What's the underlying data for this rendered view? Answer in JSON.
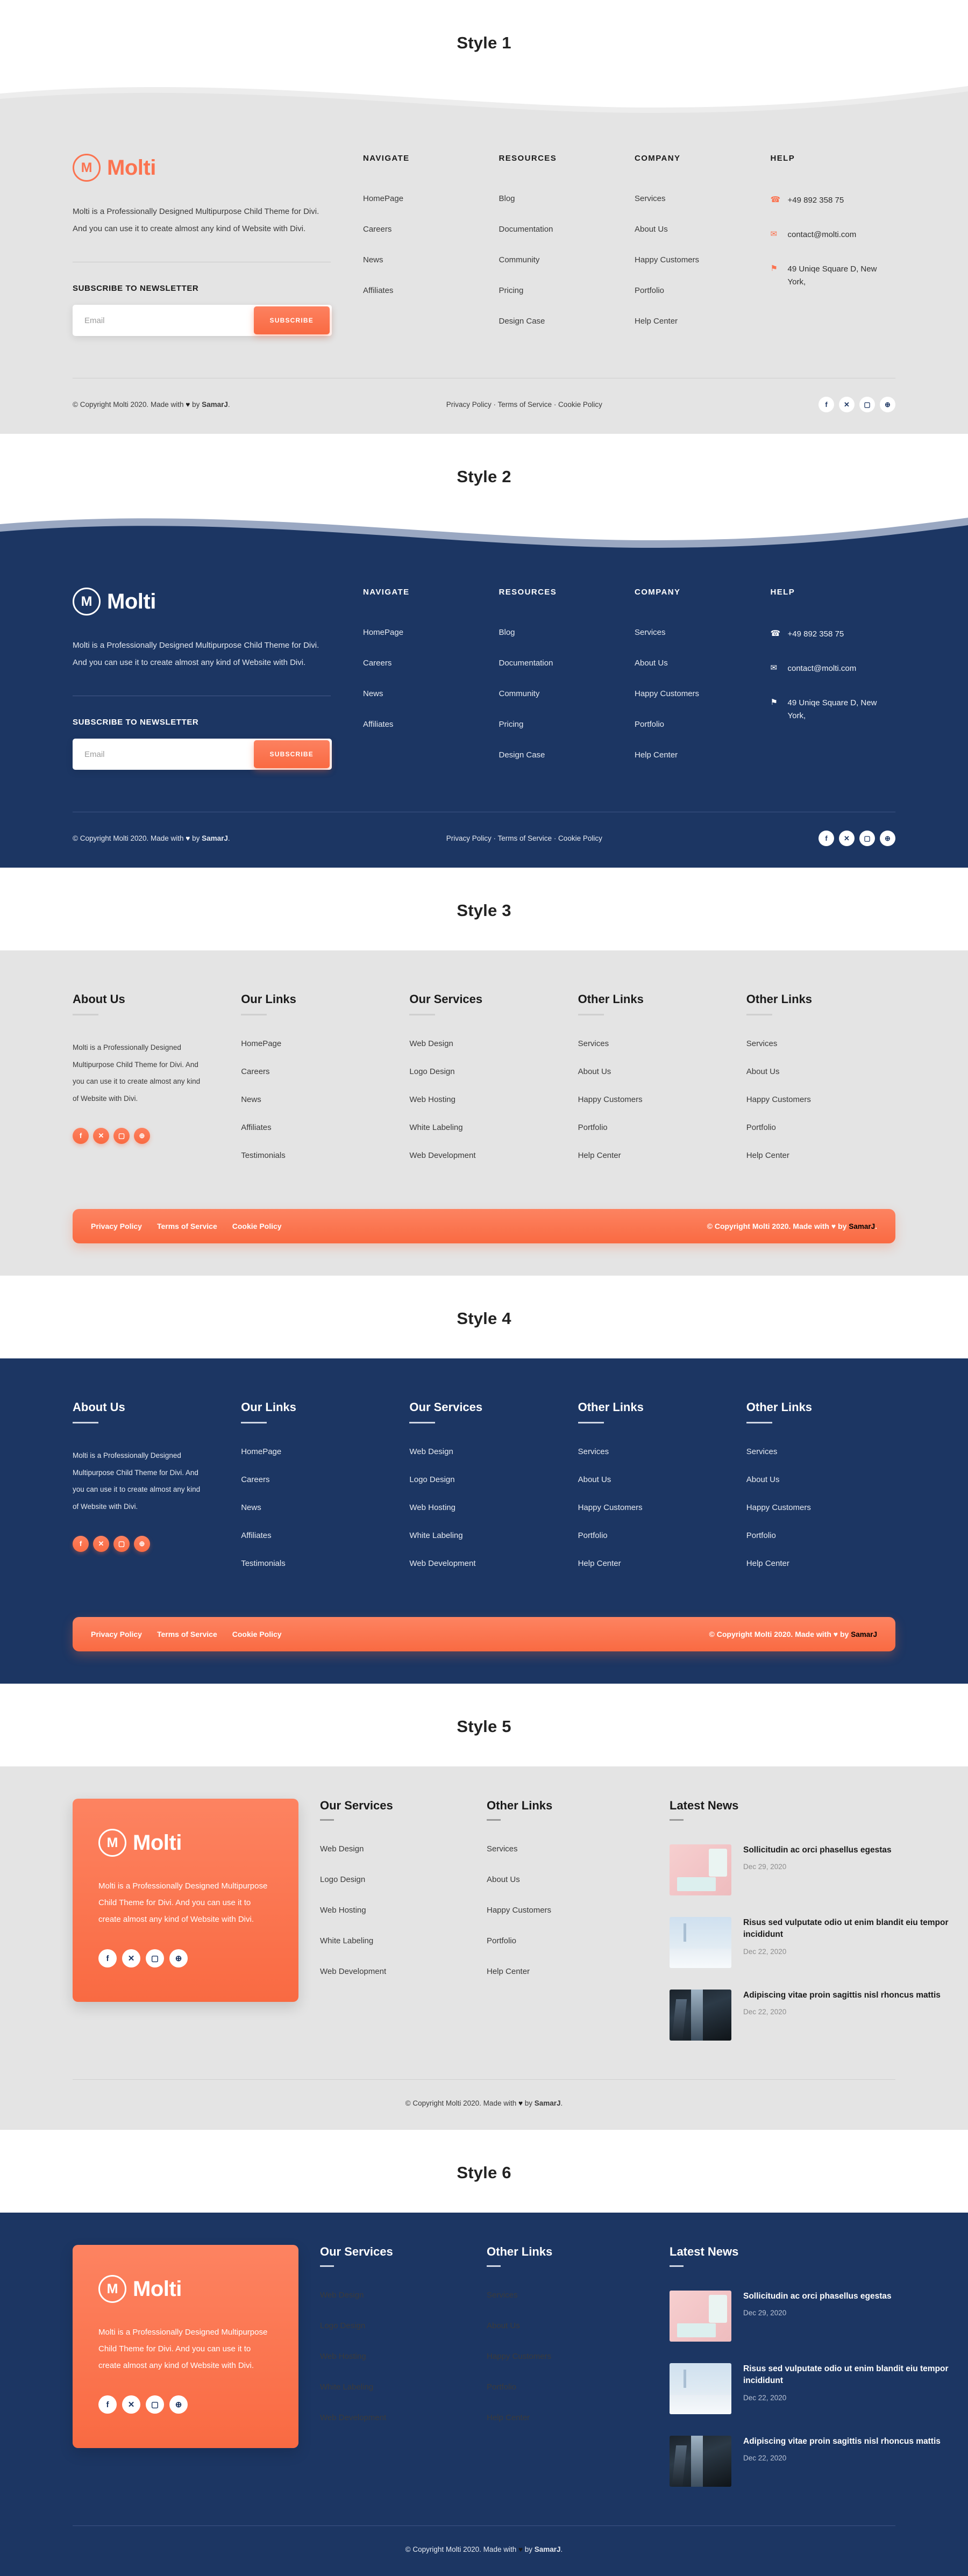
{
  "brand": {
    "name": "Molti",
    "logo_mark": "M",
    "accent": "#fb7350",
    "navy": "#1c3663",
    "light_bg": "#e4e4e4"
  },
  "styles": [
    {
      "label": "Style 1"
    },
    {
      "label": "Style 2"
    },
    {
      "label": "Style 3"
    },
    {
      "label": "Style 4"
    },
    {
      "label": "Style 5"
    },
    {
      "label": "Style 6"
    }
  ],
  "about": {
    "text": "Molti is a Professionally Designed  Multipurpose Child Theme for Divi. And you can use it to create almost any kind of Website with Divi."
  },
  "newsletter": {
    "title": "SUBSCRIBE TO NEWSLETTER",
    "placeholder": "Email",
    "value": "",
    "button": "SUBSCRIBE"
  },
  "columns": {
    "navigate": {
      "heading": "NAVIGATE",
      "items": [
        "HomePage",
        "Careers",
        "News",
        "Affiliates"
      ]
    },
    "resources": {
      "heading": "RESOURCES",
      "items": [
        "Blog",
        "Documentation",
        "Community",
        "Pricing",
        "Design Case"
      ]
    },
    "company": {
      "heading": "COMPANY",
      "items": [
        "Services",
        "About Us",
        "Happy Customers",
        "Portfolio",
        "Help Center"
      ]
    },
    "help": {
      "heading": "HELP",
      "phone": "+49 892 358 75",
      "email": "contact@molti.com",
      "address": "49 Uniqe Square D, New York,"
    }
  },
  "five_col": {
    "about_us": {
      "heading": "About Us",
      "text": "Molti is a Professionally Designed Multipurpose Child Theme for Divi. And you can use it to create almost any kind of Website with Divi."
    },
    "our_links": {
      "heading": "Our Links",
      "items": [
        "HomePage",
        "Careers",
        "News",
        "Affiliates",
        "Testimonials"
      ]
    },
    "our_services": {
      "heading": "Our Services",
      "items": [
        "Web Design",
        "Logo Design",
        "Web Hosting",
        "White Labeling",
        "Web Development"
      ]
    },
    "other_links_1": {
      "heading": "Other Links",
      "items": [
        "Services",
        "About Us",
        "Happy Customers",
        "Portfolio",
        "Help Center"
      ]
    },
    "other_links_2": {
      "heading": "Other Links",
      "items": [
        "Services",
        "About Us",
        "Happy Customers",
        "Portfolio",
        "Help Center"
      ]
    }
  },
  "news_layout": {
    "promo_text": "Molti is a Professionally Designed Multipurpose Child Theme for Divi. And you can use it to create almost any kind of Website with Divi.",
    "our_services": {
      "heading": "Our Services",
      "items": [
        "Web Design",
        "Logo Design",
        "Web Hosting",
        "White Labeling",
        "Web Development"
      ]
    },
    "other_links": {
      "heading": "Other Links",
      "items": [
        "Services",
        "About Us",
        "Happy Customers",
        "Portfolio",
        "Help Center"
      ]
    },
    "latest_news": {
      "heading": "Latest News",
      "items": [
        {
          "title": "Sollicitudin ac orci phasellus egestas",
          "date": "Dec 29, 2020",
          "thumb": "pink-desk-photo"
        },
        {
          "title": "Risus sed vulputate odio ut enim blandit eiu tempor incididunt",
          "date": "Dec 22, 2020",
          "thumb": "foggy-city-photo"
        },
        {
          "title": "Adipiscing vitae proin sagittis nisl rhoncus mattis",
          "date": "Dec 22, 2020",
          "thumb": "skyscraper-photo"
        }
      ]
    }
  },
  "footer_bar": {
    "copyright_pre": "© Copyright Molti 2020. Made with ",
    "heart": "♥",
    "copyright_mid": " by ",
    "author": "SamarJ",
    "copyright_post": ".",
    "legal": "Privacy Policy · Terms of Service · Cookie Policy",
    "legal_items": [
      "Privacy Policy",
      "Terms of Service",
      "Cookie Policy"
    ]
  },
  "social": [
    {
      "name": "facebook-icon",
      "glyph": "f"
    },
    {
      "name": "x-twitter-icon",
      "glyph": "✕"
    },
    {
      "name": "instagram-icon",
      "glyph": "▢"
    },
    {
      "name": "dribbble-icon",
      "glyph": "⊕"
    }
  ],
  "icons": {
    "phone": "☎",
    "mail": "✉",
    "pin": "⚑"
  }
}
